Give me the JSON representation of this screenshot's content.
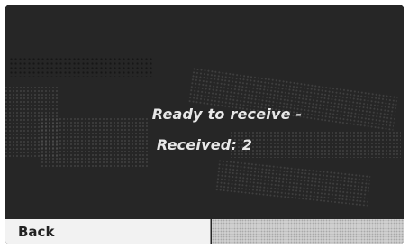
{
  "display": {
    "status_line": "Ready to receive -",
    "received_line": "Received: 2"
  },
  "softkeys": {
    "left_label": "Back",
    "right_label": ""
  },
  "colors": {
    "screen_background": "#262626",
    "text": "#e8e8e8",
    "softkey_active_background": "#f2f2f2",
    "softkey_inactive_background": "#cfcfcf"
  }
}
